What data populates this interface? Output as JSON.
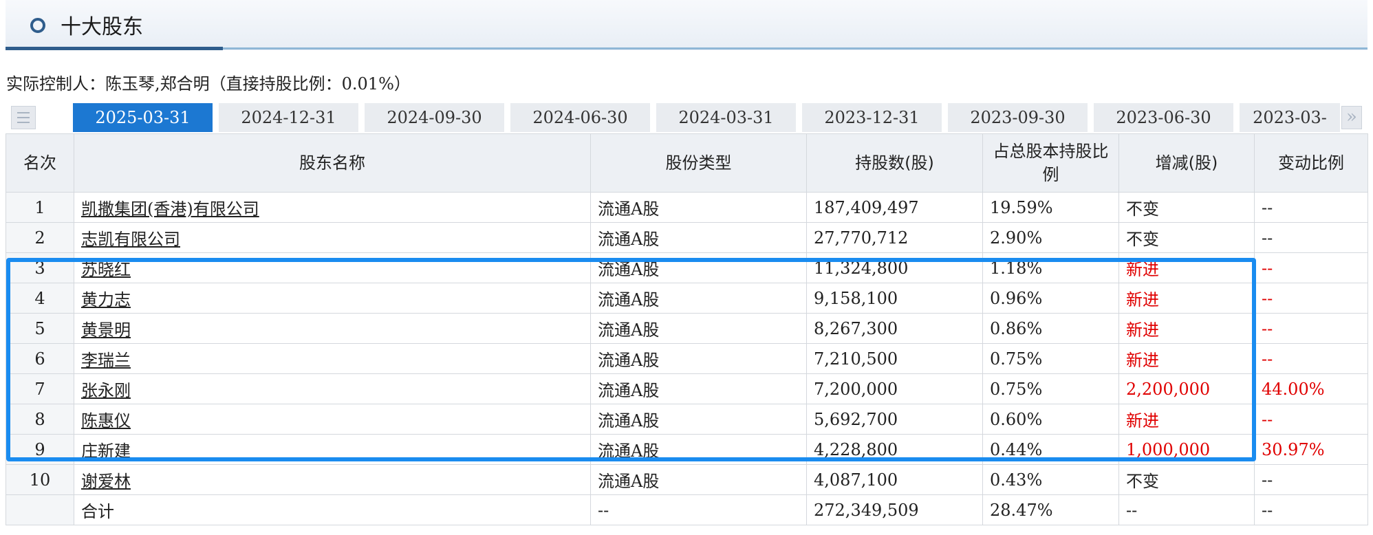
{
  "section": {
    "title": "十大股东",
    "icon": "circle-icon"
  },
  "controller_text": "实际控制人：陈玉琴,郑合明（直接持股比例：0.01%）",
  "tabs": [
    {
      "label": "2025-03-31",
      "active": true
    },
    {
      "label": "2024-12-31",
      "active": false
    },
    {
      "label": "2024-09-30",
      "active": false
    },
    {
      "label": "2024-06-30",
      "active": false
    },
    {
      "label": "2024-03-31",
      "active": false
    },
    {
      "label": "2023-12-31",
      "active": false
    },
    {
      "label": "2023-09-30",
      "active": false
    },
    {
      "label": "2023-06-30",
      "active": false
    },
    {
      "label": "2023-03-",
      "active": false
    }
  ],
  "tab_controls": {
    "prev_icon": "list-icon",
    "next_icon": "double-chevron-right-icon"
  },
  "table": {
    "headers": [
      "名次",
      "股东名称",
      "股份类型",
      "持股数(股)",
      "占总股本持股比例",
      "增减(股)",
      "变动比例"
    ],
    "rows": [
      {
        "rank": "1",
        "name": "凯撒集团(香港)有限公司",
        "type": "流通A股",
        "shares": "187,409,497",
        "pct": "19.59%",
        "change": "不变",
        "change_ratio": "--"
      },
      {
        "rank": "2",
        "name": "志凯有限公司",
        "type": "流通A股",
        "shares": "27,770,712",
        "pct": "2.90%",
        "change": "不变",
        "change_ratio": "--"
      },
      {
        "rank": "3",
        "name": "苏晓红",
        "type": "流通A股",
        "shares": "11,324,800",
        "pct": "1.18%",
        "change": "新进",
        "change_ratio": "--"
      },
      {
        "rank": "4",
        "name": "黄力志",
        "type": "流通A股",
        "shares": "9,158,100",
        "pct": "0.96%",
        "change": "新进",
        "change_ratio": "--"
      },
      {
        "rank": "5",
        "name": "黄景明",
        "type": "流通A股",
        "shares": "8,267,300",
        "pct": "0.86%",
        "change": "新进",
        "change_ratio": "--"
      },
      {
        "rank": "6",
        "name": "李瑞兰",
        "type": "流通A股",
        "shares": "7,210,500",
        "pct": "0.75%",
        "change": "新进",
        "change_ratio": "--"
      },
      {
        "rank": "7",
        "name": "张永刚",
        "type": "流通A股",
        "shares": "7,200,000",
        "pct": "0.75%",
        "change": "2,200,000",
        "change_ratio": "44.00%"
      },
      {
        "rank": "8",
        "name": "陈惠仪",
        "type": "流通A股",
        "shares": "5,692,700",
        "pct": "0.60%",
        "change": "新进",
        "change_ratio": "--"
      },
      {
        "rank": "9",
        "name": "庄新建",
        "type": "流通A股",
        "shares": "4,228,800",
        "pct": "0.44%",
        "change": "1,000,000",
        "change_ratio": "30.97%"
      },
      {
        "rank": "10",
        "name": "谢爱林",
        "type": "流通A股",
        "shares": "4,087,100",
        "pct": "0.43%",
        "change": "不变",
        "change_ratio": "--"
      }
    ],
    "total": {
      "label": "合计",
      "type": "--",
      "shares": "272,349,509",
      "pct": "28.47%",
      "change": "--",
      "change_ratio": "--"
    }
  },
  "colors": {
    "accent": "#1c78d2",
    "highlight_border": "#1a8cf0",
    "increase": "#e00000",
    "header_bar": "#2f5d8c"
  }
}
